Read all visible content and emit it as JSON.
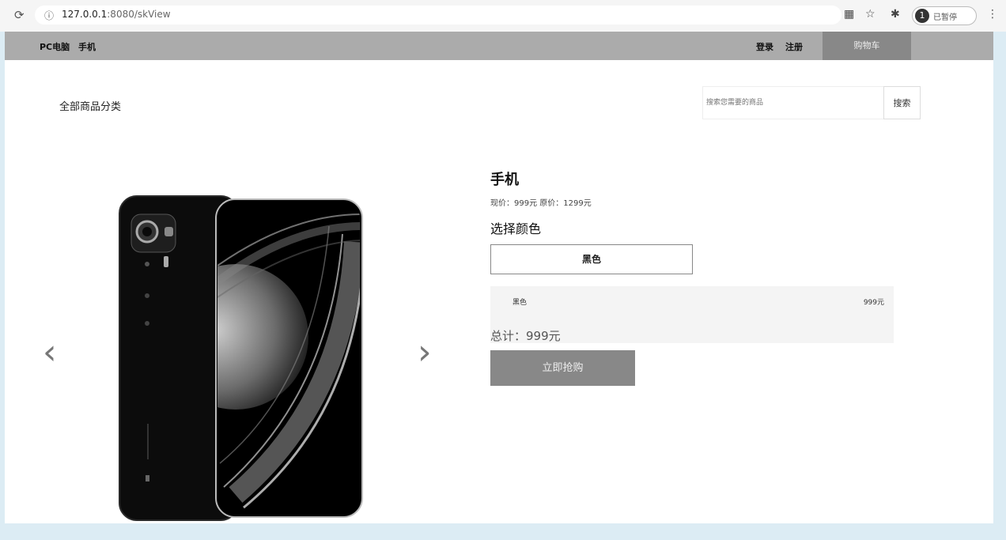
{
  "browser": {
    "url_host": "127.0.0.1",
    "url_rest": ":8080/skView",
    "profile_label": "已暂停",
    "profile_initial": "1"
  },
  "nav": {
    "left_links": [
      "PC电脑",
      "手机"
    ],
    "login": "登录",
    "register": "注册",
    "cart": "购物车"
  },
  "header": {
    "all_categories": "全部商品分类",
    "search_placeholder": "搜索您需要的商品",
    "search_button": "搜索"
  },
  "product": {
    "title": "手机",
    "price_line": "现价：999元  原价：1299元",
    "choose_color_title": "选择颜色",
    "color_option": "黑色",
    "summary_item": "黑色",
    "summary_price": "999元",
    "total": "总计：999元",
    "buy_button": "立即抢购"
  },
  "carousel": {
    "prev_glyph": "‹",
    "next_glyph": "›"
  }
}
